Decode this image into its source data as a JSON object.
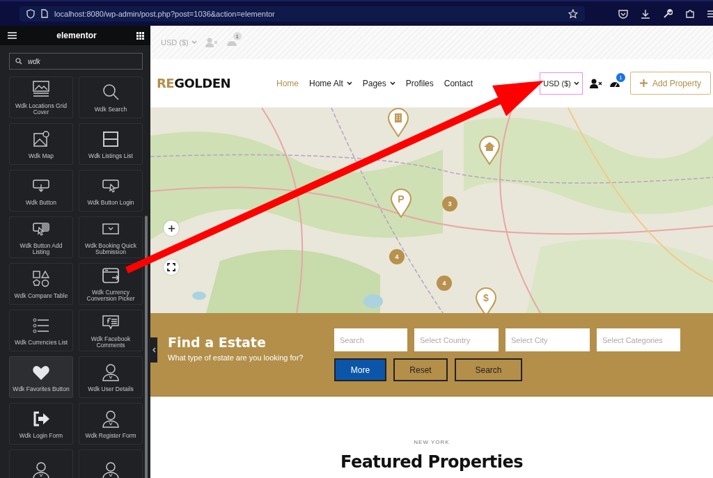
{
  "browser": {
    "url": "localhost:8080/wp-admin/post.php?post=1036&action=elementor"
  },
  "editor": {
    "title": "elementor",
    "search": {
      "value": "wdk"
    },
    "widgets": [
      {
        "label": "Wdk Locations Grid Cover",
        "selected": false
      },
      {
        "label": "Wdk Search",
        "selected": false
      },
      {
        "label": "Wdk Map",
        "selected": false
      },
      {
        "label": "Wdk Listings List",
        "selected": false
      },
      {
        "label": "Wdk Button",
        "selected": false
      },
      {
        "label": "Wdk Button Login",
        "selected": false
      },
      {
        "label": "Wdk Button Add Listing",
        "selected": false
      },
      {
        "label": "Wdk Booking Quick Submission",
        "selected": false
      },
      {
        "label": "Wdk Compare Table",
        "selected": false
      },
      {
        "label": "Wdk Currency Conversion Picker",
        "selected": false
      },
      {
        "label": "Wdk Currencies List",
        "selected": false
      },
      {
        "label": "Wdk Facebook Comments",
        "selected": false
      },
      {
        "label": "Wdk Favorites Button",
        "selected": true
      },
      {
        "label": "Wdk User Details",
        "selected": false
      },
      {
        "label": "Wdk Login Form",
        "selected": false
      },
      {
        "label": "Wdk Register Form",
        "selected": false
      },
      {
        "selected": false
      },
      {
        "selected": false
      }
    ]
  },
  "site": {
    "top_bar": {
      "currency": "USD ($)",
      "badge": "1"
    },
    "logo": {
      "accent": "RE",
      "rest": "GOLDEN"
    },
    "nav": [
      {
        "label": "Home",
        "selected": true,
        "dropdown": false
      },
      {
        "label": "Home Alt",
        "selected": false,
        "dropdown": true
      },
      {
        "label": "Pages",
        "selected": false,
        "dropdown": true
      },
      {
        "label": "Profiles",
        "selected": false,
        "dropdown": false
      },
      {
        "label": "Contact",
        "selected": false,
        "dropdown": false
      }
    ],
    "currency": "USD ($)",
    "badge": "1",
    "add_button": "Add Property",
    "map": {
      "markers": [
        {
          "kind": "pin"
        },
        {
          "kind": "pin"
        },
        {
          "kind": "pin",
          "glyph": "P"
        },
        {
          "kind": "cluster",
          "count": "3"
        },
        {
          "kind": "cluster",
          "count": "4"
        },
        {
          "kind": "cluster",
          "count": "4"
        },
        {
          "kind": "pin",
          "glyph": "$"
        }
      ]
    },
    "search_band": {
      "title": "Find a Estate",
      "subtitle": "What type of estate are you looking for?",
      "fields": [
        {
          "placeholder": "Search"
        },
        {
          "placeholder": "Select Country"
        },
        {
          "placeholder": "Select City"
        },
        {
          "placeholder": "Select Categories"
        }
      ],
      "buttons": [
        {
          "label": "More",
          "kind": "primary"
        },
        {
          "label": "Reset",
          "kind": "outline"
        },
        {
          "label": "Search",
          "kind": "outline"
        }
      ]
    },
    "section": {
      "eyebrow": "NEW YORK",
      "title": "Featured Properties"
    }
  }
}
